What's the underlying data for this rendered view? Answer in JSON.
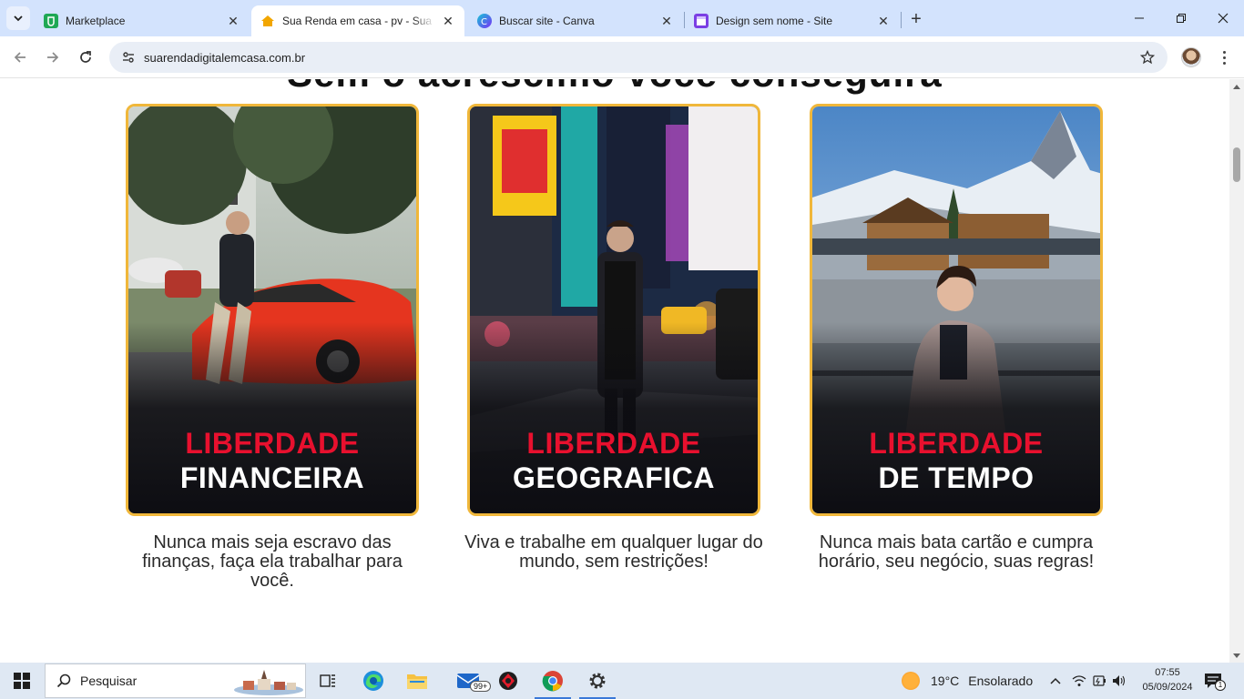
{
  "browser": {
    "tabs": [
      {
        "title": "Marketplace",
        "favicon": "marketplace-icon",
        "active": false
      },
      {
        "title": "Sua Renda em casa - pv - Sua renda",
        "favicon": "house-icon",
        "active": true
      },
      {
        "title": "Buscar site - Canva",
        "favicon": "canva-icon",
        "active": false
      },
      {
        "title": "Design sem nome - Site",
        "favicon": "calendar-icon",
        "active": false
      }
    ],
    "url": "suarendadigitalemcasa.com.br"
  },
  "page": {
    "partial_heading": "Sem o acréscimo você conseguirá",
    "cards": [
      {
        "line1": "LIBERDADE",
        "line2": "FINANCEIRA",
        "description": "Nunca mais seja escravo das finanças, faça ela trabalhar para você."
      },
      {
        "line1": "LIBERDADE",
        "line2": "GEOGRAFICA",
        "description": "Viva e trabalhe em qualquer lugar do mundo, sem restrições!"
      },
      {
        "line1": "LIBERDADE",
        "line2": "DE TEMPO",
        "description": "Nunca mais bata cartão e cumpra horário, seu negócio, suas regras!"
      }
    ]
  },
  "taskbar": {
    "search_label": "Pesquisar",
    "mail_badge": "99+",
    "weather_temp": "19°C",
    "weather_condition": "Ensolarado",
    "time": "07:55",
    "date": "05/09/2024",
    "notification_count": "1"
  },
  "colors": {
    "card_border": "#f0b73a",
    "caption_red": "#e8102e",
    "tabstrip": "#d3e3fd",
    "taskbar": "#dfe8f3"
  }
}
